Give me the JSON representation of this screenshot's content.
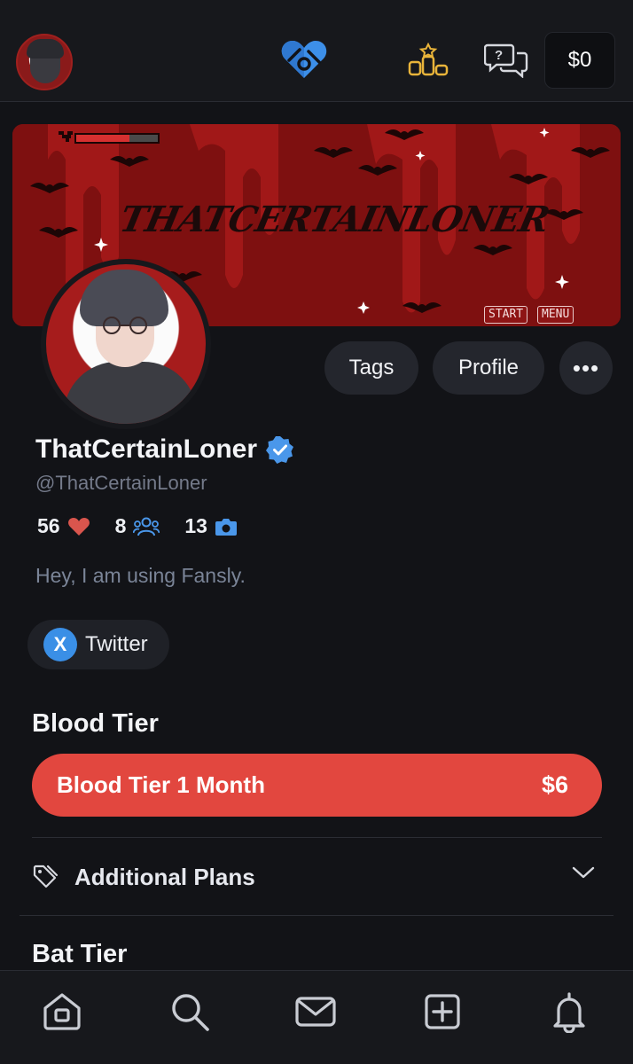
{
  "header": {
    "wallet_label": "$0",
    "icons": [
      "user-avatar",
      "fansly-logo-heart",
      "leaderboard-icon",
      "chat-help-icon"
    ]
  },
  "banner": {
    "title": "THATCERTAINLONER",
    "start_label": "START",
    "menu_label": "MENU"
  },
  "actions": {
    "tags_label": "Tags",
    "profile_label": "Profile",
    "more_label": "•••"
  },
  "profile": {
    "display_name": "ThatCertainLoner",
    "handle": "@ThatCertainLoner",
    "likes": "56",
    "followers": "8",
    "media": "13",
    "bio": "Hey, I am using Fansly."
  },
  "social": {
    "twitter_label": "Twitter",
    "x_glyph": "X"
  },
  "tiers": {
    "blood_title": "Blood Tier",
    "blood_button_label": "Blood Tier 1 Month",
    "blood_button_price": "$6",
    "additional_plans_label": "Additional Plans",
    "bat_title": "Bat Tier"
  },
  "colors": {
    "accent_blue": "#3a8fe6",
    "tier_red": "#e2473f",
    "heart_red": "#d9554d",
    "background": "#121317"
  },
  "bottom_nav": [
    "home-icon",
    "search-icon",
    "messages-icon",
    "create-post-icon",
    "notifications-icon"
  ]
}
